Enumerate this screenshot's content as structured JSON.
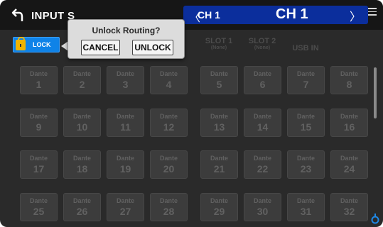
{
  "header": {
    "title": "INPUT S",
    "channel_nav": {
      "prev_symbol": "〈",
      "current_small": "CH 1",
      "current_large": "CH 1",
      "next_symbol": "〉"
    }
  },
  "lock": {
    "label": "LOCK"
  },
  "columns": [
    {
      "name": "SLOT 1",
      "sub": "(None)"
    },
    {
      "name": "SLOT 2",
      "sub": "(None)"
    },
    {
      "name": "USB IN",
      "sub": ""
    }
  ],
  "grid": [
    {
      "label": "Dante",
      "number": "1"
    },
    {
      "label": "Dante",
      "number": "2"
    },
    {
      "label": "Dante",
      "number": "3"
    },
    {
      "label": "Dante",
      "number": "4"
    },
    {
      "label": "Dante",
      "number": "5"
    },
    {
      "label": "Dante",
      "number": "6"
    },
    {
      "label": "Dante",
      "number": "7"
    },
    {
      "label": "Dante",
      "number": "8"
    },
    {
      "label": "Dante",
      "number": "9"
    },
    {
      "label": "Dante",
      "number": "10"
    },
    {
      "label": "Dante",
      "number": "11"
    },
    {
      "label": "Dante",
      "number": "12"
    },
    {
      "label": "Dante",
      "number": "13"
    },
    {
      "label": "Dante",
      "number": "14"
    },
    {
      "label": "Dante",
      "number": "15"
    },
    {
      "label": "Dante",
      "number": "16"
    },
    {
      "label": "Dante",
      "number": "17"
    },
    {
      "label": "Dante",
      "number": "18"
    },
    {
      "label": "Dante",
      "number": "19"
    },
    {
      "label": "Dante",
      "number": "20"
    },
    {
      "label": "Dante",
      "number": "21"
    },
    {
      "label": "Dante",
      "number": "22"
    },
    {
      "label": "Dante",
      "number": "23"
    },
    {
      "label": "Dante",
      "number": "24"
    },
    {
      "label": "Dante",
      "number": "25"
    },
    {
      "label": "Dante",
      "number": "26"
    },
    {
      "label": "Dante",
      "number": "27"
    },
    {
      "label": "Dante",
      "number": "28"
    },
    {
      "label": "Dante",
      "number": "29"
    },
    {
      "label": "Dante",
      "number": "30"
    },
    {
      "label": "Dante",
      "number": "31"
    },
    {
      "label": "Dante",
      "number": "32"
    }
  ],
  "dialog": {
    "title": "Unlock Routing?",
    "cancel_label": "CANCEL",
    "unlock_label": "UNLOCK"
  },
  "colors": {
    "accent_blue": "#0b2e9c",
    "lock_blue": "#0f83e8",
    "lock_yellow": "#f0b400"
  }
}
